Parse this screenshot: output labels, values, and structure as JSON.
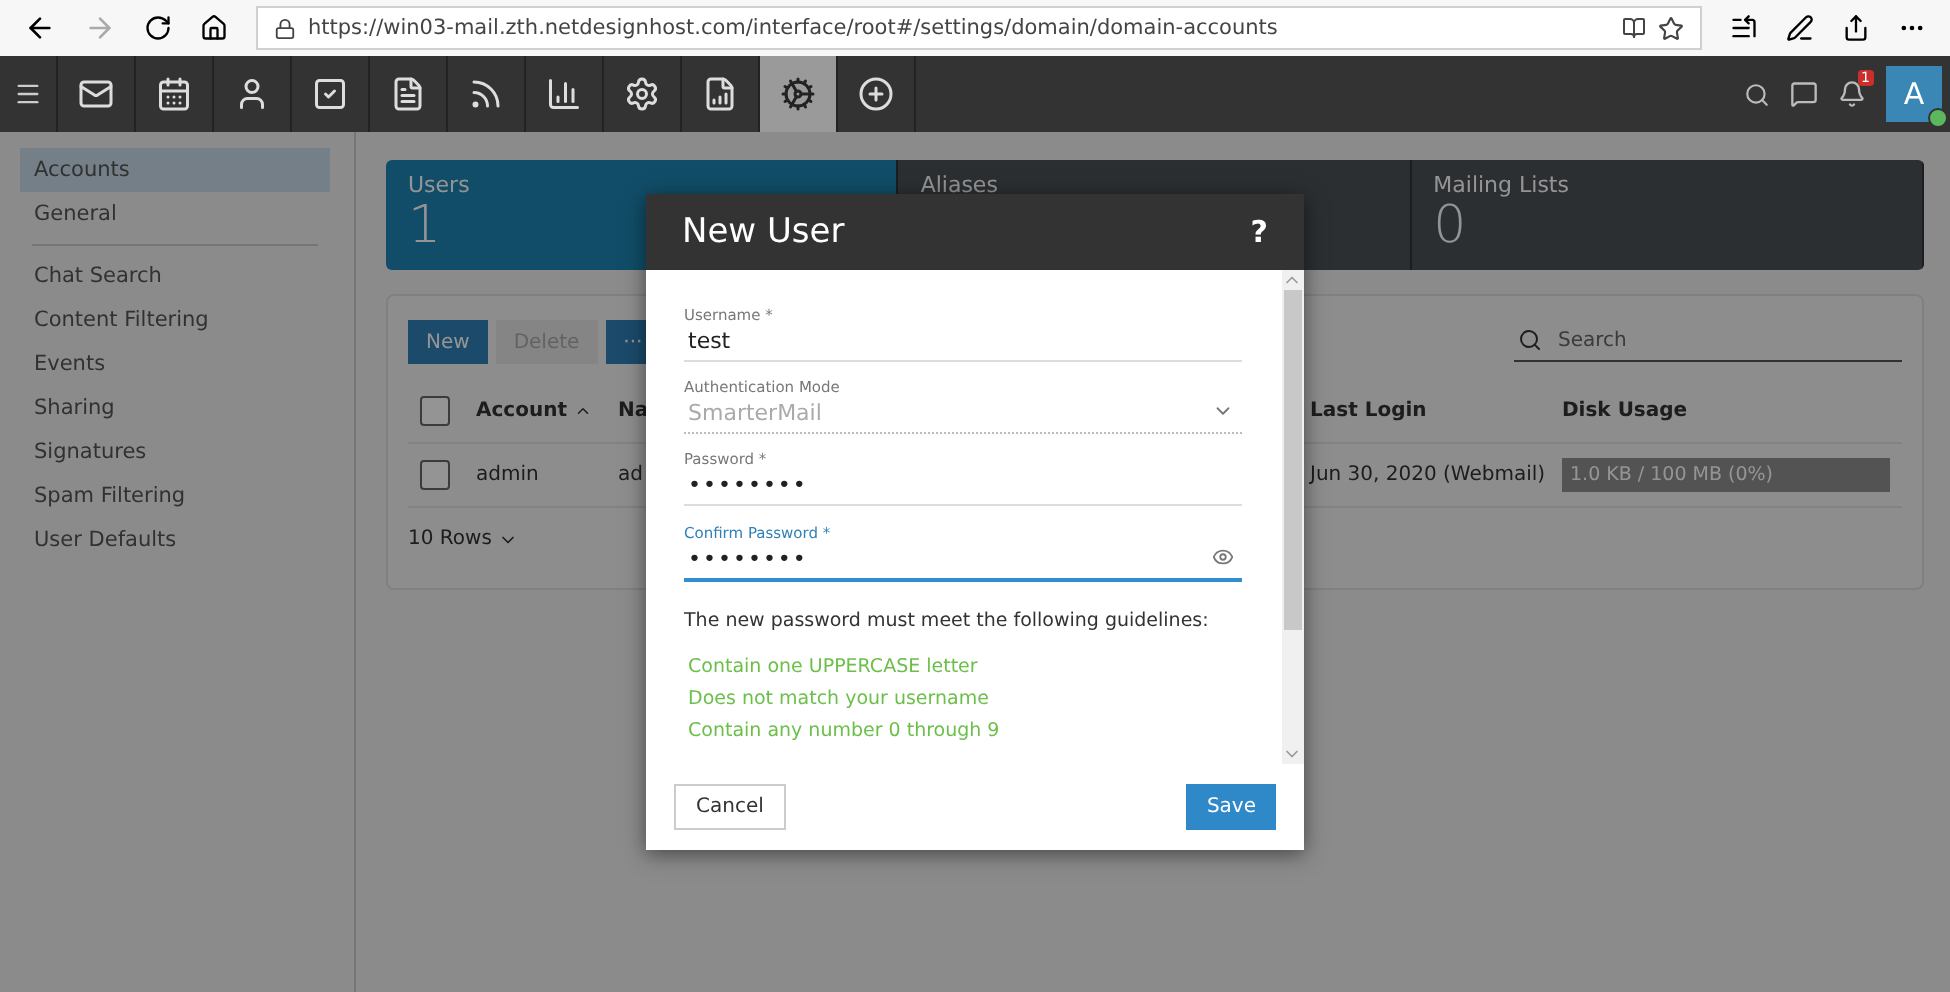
{
  "browser": {
    "url": "https://win03-mail.zth.netdesignhost.com/interface/root#/settings/domain/domain-accounts"
  },
  "toolbar": {
    "apps": [
      {
        "kind": "mail",
        "selected": false
      },
      {
        "kind": "calendar",
        "selected": false
      },
      {
        "kind": "contacts",
        "selected": false
      },
      {
        "kind": "tasks",
        "selected": false
      },
      {
        "kind": "notes",
        "selected": false
      },
      {
        "kind": "feeds",
        "selected": false
      },
      {
        "kind": "reports",
        "selected": false
      },
      {
        "kind": "settings",
        "selected": false
      },
      {
        "kind": "domain-reports",
        "selected": false
      },
      {
        "kind": "domain-settings",
        "selected": true
      },
      {
        "kind": "add",
        "selected": false
      }
    ],
    "notification_count": "1",
    "avatar": "A"
  },
  "sidebar": {
    "groups": [
      [
        {
          "label": "Accounts",
          "selected": true
        },
        {
          "label": "General",
          "selected": false
        }
      ],
      [
        {
          "label": "Chat Search",
          "selected": false
        },
        {
          "label": "Content Filtering",
          "selected": false
        },
        {
          "label": "Events",
          "selected": false
        },
        {
          "label": "Sharing",
          "selected": false
        },
        {
          "label": "Signatures",
          "selected": false
        },
        {
          "label": "Spam Filtering",
          "selected": false
        },
        {
          "label": "User Defaults",
          "selected": false
        }
      ]
    ]
  },
  "summary_cards": [
    {
      "label": "Users",
      "count": "1",
      "selected": true
    },
    {
      "label": "Aliases",
      "selected": false
    },
    {
      "label": "Mailing Lists",
      "count": "0",
      "selected": false
    }
  ],
  "actions": [
    {
      "label": "New",
      "disabled": false
    },
    {
      "label": "Delete",
      "disabled": true
    },
    {
      "label": "···",
      "disabled": false
    }
  ],
  "search": {
    "placeholder": "Search"
  },
  "table": {
    "columns": [
      {
        "label": "Account",
        "sorted": true
      },
      {
        "label": "Na"
      },
      {
        "label": "Last Login",
        "sorted": false
      },
      {
        "label": "Disk Usage",
        "sorted": false
      }
    ],
    "select_all_checked": false,
    "rows": [
      {
        "checked": false,
        "account": "admin",
        "name": "ad",
        "last_login": "Jun 30, 2020 (Webmail)",
        "disk_usage": "1.0 KB / 100 MB (0%)",
        "level": 0
      }
    ]
  },
  "rows_per_page": "10 Rows",
  "dialog": {
    "title": "New User",
    "help": "?",
    "fields": [
      {
        "kind": "text",
        "label": "Username *",
        "value": "test",
        "focused": false,
        "disabled": false
      },
      {
        "kind": "select",
        "label": "Authentication Mode",
        "value": "SmarterMail",
        "focused": false,
        "disabled": true
      },
      {
        "kind": "password",
        "label": "Password *",
        "value": "••••••••",
        "focused": false,
        "disabled": false
      },
      {
        "kind": "password",
        "label": "Confirm Password *",
        "value": "••••••••",
        "focused": true,
        "disabled": false
      }
    ],
    "guidelines_intro": "The new password must meet the following guidelines:",
    "guidelines": [
      {
        "text": "Contain one UPPERCASE letter",
        "met": true
      },
      {
        "text": "Does not match your username",
        "met": true
      },
      {
        "text": "Contain any number 0 through 9",
        "met": true
      }
    ],
    "buttons": [
      {
        "label": "Cancel",
        "kind": "secondary"
      },
      {
        "label": "Save",
        "kind": "primary"
      }
    ]
  }
}
